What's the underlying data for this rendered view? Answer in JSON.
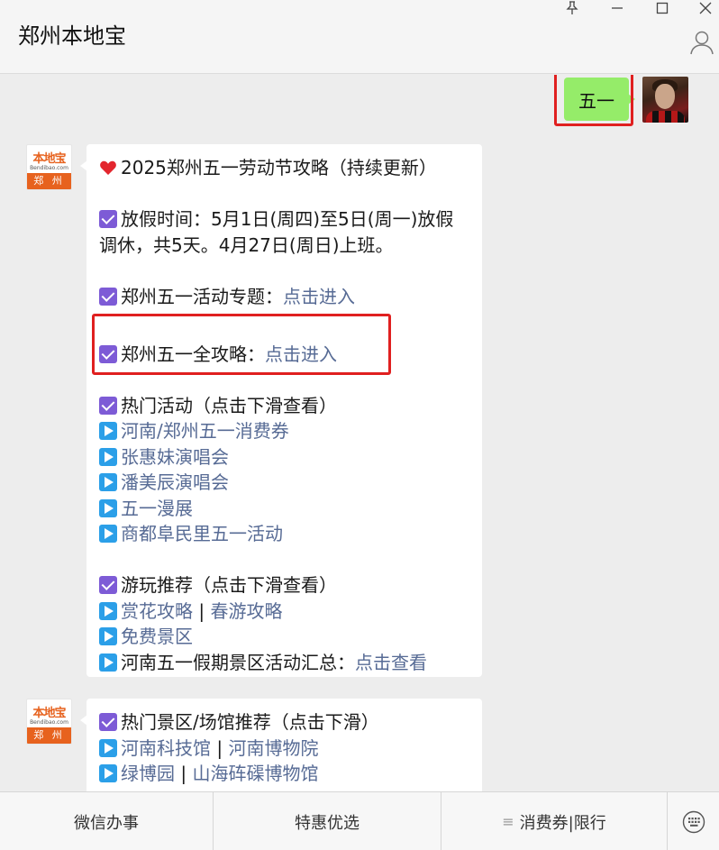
{
  "window": {
    "title": "郑州本地宝"
  },
  "chat": {
    "my_message": "五一",
    "bot_avatar": {
      "logo": "本地宝",
      "logo_sub": "Bendibao.com",
      "city": "郑 州"
    },
    "message1": {
      "lines": [
        {
          "icon": "heart-icon",
          "text": "2025郑州五一劳动节攻略（持续更新）"
        },
        {
          "icon": "checkbox-icon",
          "text": "放假时间：5月1日(周四)至5日(周一)放假"
        },
        {
          "text": "调休，共5天。4月27日(周日)上班。"
        },
        {
          "icon": "checkbox-icon",
          "text": "郑州五一活动专题：",
          "link": "点击进入"
        },
        {
          "icon": "checkbox-icon",
          "text": "郑州五一全攻略：",
          "link": "点击进入"
        },
        {
          "icon": "checkbox-icon",
          "text": "热门活动（点击下滑查看）"
        },
        {
          "icon": "play-icon",
          "link": "河南/郑州五一消费券"
        },
        {
          "icon": "play-icon",
          "link": "张惠妹演唱会"
        },
        {
          "icon": "play-icon",
          "link": "潘美辰演唱会"
        },
        {
          "icon": "play-icon",
          "link": "五一漫展"
        },
        {
          "icon": "play-icon",
          "link": "商都阜民里五一活动"
        },
        {
          "icon": "checkbox-icon",
          "text": "游玩推荐（点击下滑查看）"
        },
        {
          "icon": "play-icon",
          "link": "赏花攻略",
          "sep": " | ",
          "link2": "春游攻略"
        },
        {
          "icon": "play-icon",
          "link": "免费景区"
        },
        {
          "icon": "play-icon",
          "text": "河南五一假期景区活动汇总：",
          "link": "点击查看"
        }
      ]
    },
    "message2": {
      "lines": [
        {
          "icon": "checkbox-icon",
          "text": "热门景区/场馆推荐（点击下滑）"
        },
        {
          "icon": "play-icon",
          "link": "河南科技馆",
          "sep": " | ",
          "link2": "河南博物院"
        },
        {
          "icon": "play-icon",
          "link": "绿博园",
          "sep": " | ",
          "link2": "山海砗磲博物馆"
        }
      ]
    }
  },
  "menu": {
    "items": [
      "微信办事",
      "特惠优选",
      "消费券|限行"
    ]
  },
  "colors": {
    "my_bubble": "#95ec69",
    "link": "#576b95",
    "checkbox": "#7d5bd6",
    "play": "#2b9fe8",
    "highlight_box": "#e02020"
  }
}
